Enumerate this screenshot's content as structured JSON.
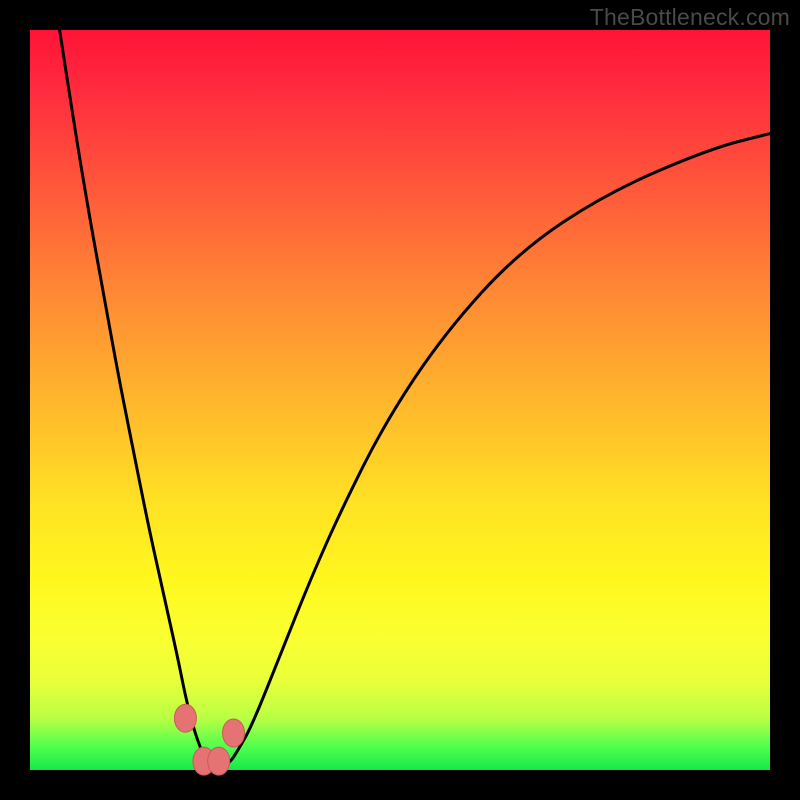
{
  "watermark": "TheBottleneck.com",
  "colors": {
    "background": "#000000",
    "curve_stroke": "#000000",
    "marker_fill": "#e57373",
    "marker_stroke": "#c85a5a",
    "gradient_stops": [
      "#ff1438",
      "#ff8a34",
      "#ffe224",
      "#faff30",
      "#14e84a"
    ]
  },
  "chart_data": {
    "type": "line",
    "title": "",
    "xlabel": "",
    "ylabel": "",
    "xlim": [
      0,
      100
    ],
    "ylim": [
      0,
      100
    ],
    "grid": false,
    "legend": false,
    "series": [
      {
        "name": "bottleneck-curve",
        "x": [
          4,
          6,
          8,
          10,
          12,
          14,
          16,
          18,
          20,
          21,
          22,
          23,
          24,
          25,
          26,
          27,
          28,
          30,
          34,
          38,
          42,
          48,
          56,
          66,
          78,
          92,
          100
        ],
        "y": [
          100,
          87,
          75,
          64,
          53,
          43,
          33,
          24,
          15,
          10,
          6,
          3,
          1,
          0.5,
          0.5,
          1,
          2.5,
          6,
          16,
          26,
          35,
          47,
          59,
          70,
          78,
          84,
          86
        ]
      }
    ],
    "markers": [
      {
        "x": 21.0,
        "y": 7.0
      },
      {
        "x": 23.5,
        "y": 1.2
      },
      {
        "x": 25.5,
        "y": 1.2
      },
      {
        "x": 27.5,
        "y": 5.0
      }
    ],
    "gradient_meaning": "y-axis color scale: top=red (high bottleneck), bottom=green (no bottleneck)"
  }
}
